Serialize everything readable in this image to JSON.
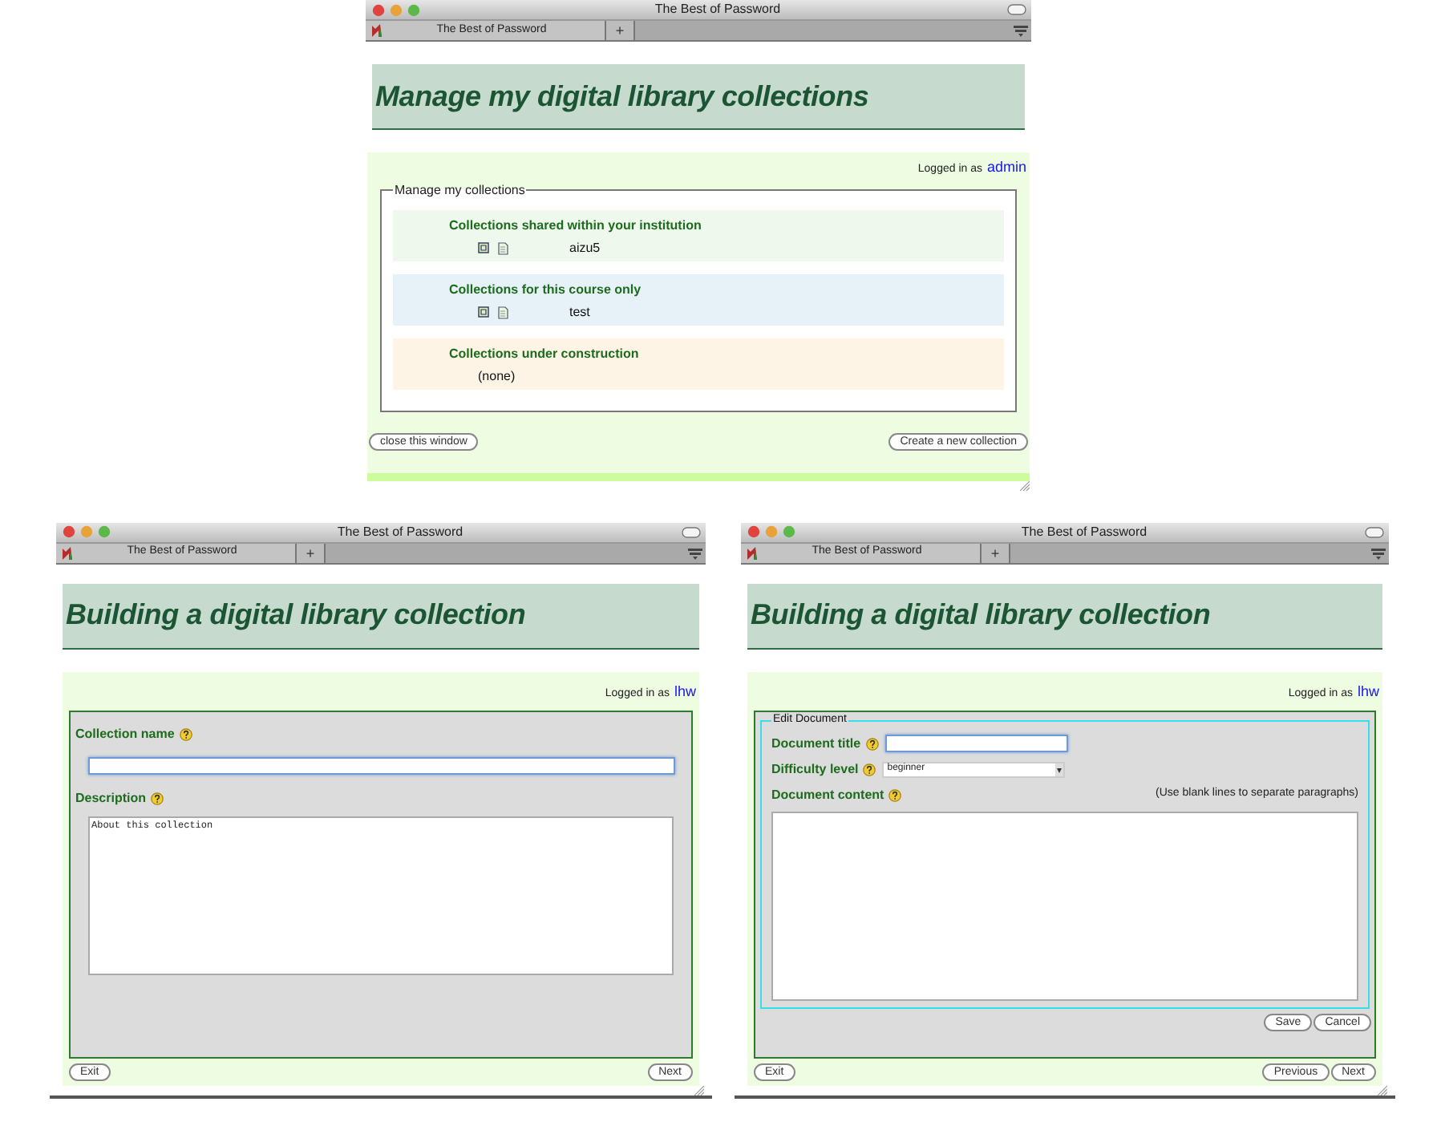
{
  "windows": [
    {
      "kind": "manage",
      "title": "The Best of Password",
      "tab_label": "The Best of Password",
      "new_tab": "+",
      "heading": "Manage my digital library collections",
      "login_prefix": "Logged in as",
      "login_user": "admin",
      "legend": "Manage my collections",
      "groups": [
        {
          "title": "Collections shared within your institution",
          "color": "#eef8ec",
          "items": [
            {
              "kind": "collection",
              "name": "aizu5"
            }
          ]
        },
        {
          "title": "Collections for this course only",
          "color": "#e6f2f8",
          "items": [
            {
              "kind": "collection",
              "name": "test"
            }
          ]
        },
        {
          "title": "Collections under construction",
          "color": "#fdf4e6",
          "items": [
            {
              "kind": "empty",
              "name": "(none)"
            }
          ]
        }
      ],
      "buttons": [
        {
          "label": "close this window"
        },
        {
          "label": "Create a new collection"
        }
      ]
    },
    {
      "kind": "build",
      "title": "The Best of Password",
      "tab_label": "The Best of Password",
      "new_tab": "+",
      "heading": "Building a digital library collection",
      "login_prefix": "Logged in as",
      "login_user": "lhw",
      "fields": [
        {
          "kind": "input",
          "label": "Collection name",
          "focused": true
        },
        {
          "kind": "textarea",
          "label": "Description",
          "value": "About this collection"
        }
      ],
      "buttons": [
        {
          "label": "Exit"
        },
        {
          "label": "Next"
        }
      ]
    },
    {
      "kind": "build",
      "title": "The Best of Password",
      "tab_label": "The Best of Password",
      "new_tab": "+",
      "heading": "Building a digital library collection",
      "login_prefix": "Logged in as",
      "login_user": "lhw",
      "legend": "Edit Document",
      "fields": [
        {
          "kind": "input",
          "label": "Document title",
          "focused": true
        },
        {
          "kind": "select",
          "label": "Difficulty level",
          "value": "beginner"
        },
        {
          "kind": "textarea",
          "label": "Document content",
          "hint": "(Use blank lines to separate paragraphs)"
        }
      ],
      "inner_buttons": [
        {
          "label": "Save"
        },
        {
          "label": "Cancel"
        }
      ],
      "buttons": [
        {
          "label": "Exit"
        },
        {
          "label": "Previous"
        },
        {
          "label": "Next"
        }
      ]
    }
  ]
}
